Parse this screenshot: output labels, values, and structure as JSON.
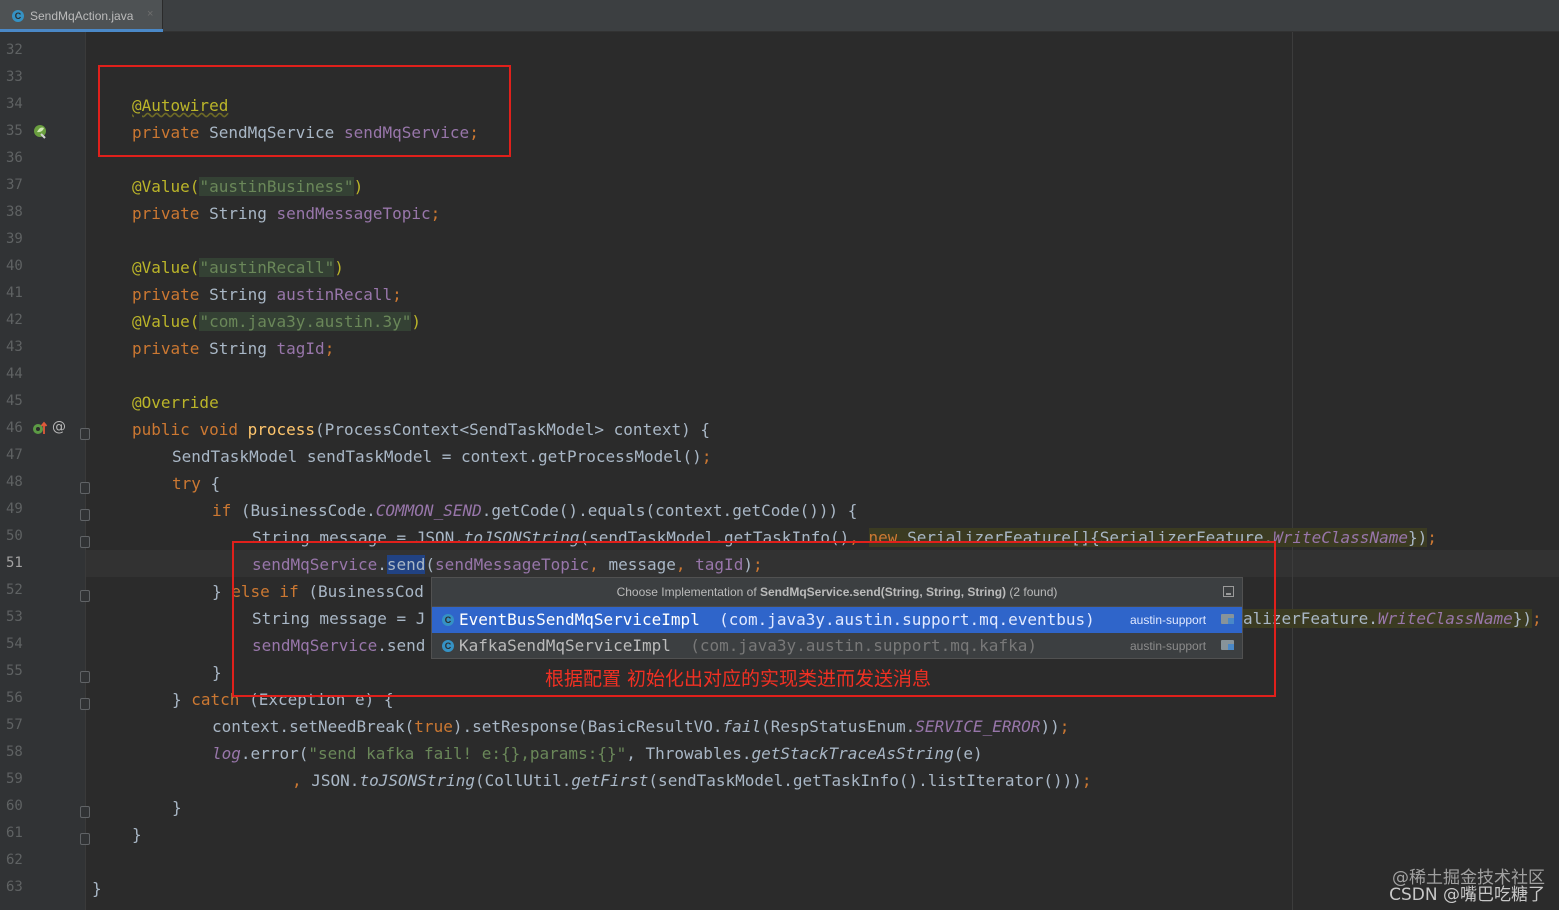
{
  "tab": {
    "icon": "C",
    "filename": "SendMqAction.java",
    "close": "×"
  },
  "gutter": {
    "line_numbers": [
      "32",
      "33",
      "34",
      "35",
      "36",
      "37",
      "38",
      "39",
      "40",
      "41",
      "42",
      "43",
      "44",
      "45",
      "46",
      "47",
      "48",
      "49",
      "50",
      "51",
      "52",
      "53",
      "54",
      "55",
      "56",
      "57",
      "58",
      "59",
      "60",
      "61",
      "62",
      "63"
    ],
    "current_line": "51",
    "icons": {
      "line35": "spring-bean-icon",
      "line46_override": "override-up-arrow-icon",
      "line46_at": "@"
    }
  },
  "code": {
    "l34_annotation": "@Autowired",
    "l35_private": "private",
    "l35_type": "SendMqService",
    "l35_field": "sendMqService",
    "l37_annotation": "@Value(",
    "l37_string": "\"austinBusiness\"",
    "l37_close": ")",
    "l38_private": "private",
    "l38_type": "String",
    "l38_field": "sendMessageTopic",
    "l40_annotation": "@Value(",
    "l40_string": "\"austinRecall\"",
    "l40_close": ")",
    "l41_private": "private",
    "l41_type": "String",
    "l41_field": "austinRecall",
    "l42_annotation": "@Value(",
    "l42_string": "\"com.java3y.austin.3y\"",
    "l42_close": ")",
    "l43_private": "private",
    "l43_type": "String",
    "l43_field": "tagId",
    "l45_annotation": "@Override",
    "l46_public": "public",
    "l46_void": "void",
    "l46_method": "process",
    "l46_rest": "(ProcessContext<SendTaskModel> context) {",
    "l47_text": "SendTaskModel sendTaskModel = context.getProcessModel()",
    "l48_try": "try",
    "l48_rest": " {",
    "l49_if": "if",
    "l49_a": " (BusinessCode.",
    "l49_const": "COMMON_SEND",
    "l49_b": ".getCode().equals(context.getCode())) {",
    "l50_a": "String message = JSON.",
    "l50_method": "toJSONString",
    "l50_b": "(sendTaskModel.getTaskInfo()",
    "l50_comma": ",",
    "l50_new": "new",
    "l50_c": "SerializerFeature[]{SerializerFeature.",
    "l50_const": "WriteClassName",
    "l50_d": "})",
    "l51_field": "sendMqService",
    "l51_dot": ".",
    "l51_send": "send",
    "l51_open": "(",
    "l51_arg1": "sendMessageTopic",
    "l51_comma1": ",",
    "l51_arg2": " message",
    "l51_comma2": ",",
    "l51_arg3": "tagId",
    "l51_close": ")",
    "l52_close": "} ",
    "l52_else": "else if",
    "l52_rest": " (BusinessCod",
    "l53_text": "String message = J",
    "l53_right": "alizerFeature.",
    "l53_const": "WriteClassName",
    "l53_end": "})",
    "l54_field": "sendMqService",
    "l54_text": ".send",
    "l55_text": "}",
    "l56_close": "} ",
    "l56_catch": "catch",
    "l56_rest": " (Exception e) {",
    "l57_a": "context.setNeedBreak(",
    "l57_true": "true",
    "l57_b": ").setResponse(BasicResultVO.",
    "l57_fail": "fail",
    "l57_c": "(RespStatusEnum.",
    "l57_const": "SERVICE_ERROR",
    "l57_d": "))",
    "l58_log": "log",
    "l58_a": ".error(",
    "l58_string": "\"send kafka fail! e:{},params:{}\"",
    "l58_b": ", Throwables.",
    "l58_method": "getStackTraceAsString",
    "l58_c": "(e)",
    "l59_comma": ",",
    "l59_a": " JSON.",
    "l59_method": "toJSONString",
    "l59_b": "(CollUtil.",
    "l59_method2": "getFirst",
    "l59_c": "(sendTaskModel.getTaskInfo().listIterator()))",
    "l60_text": "}",
    "l61_text": "}",
    "l63_text": "}",
    "semicolon": ";"
  },
  "popup": {
    "header_prefix": "Choose Implementation of ",
    "header_bold": "SendMqService.send(String, String, String)",
    "header_suffix": " (2 found)",
    "pin_icon": "pin-icon",
    "items": [
      {
        "icon": "C",
        "name": "EventBusSendMqServiceImpl",
        "package": "(com.java3y.austin.support.mq.eventbus)",
        "module": "austin-support",
        "selected": true
      },
      {
        "icon": "C",
        "name": "KafkaSendMqServiceImpl",
        "package": "(com.java3y.austin.support.mq.kafka)",
        "module": "austin-support",
        "selected": false
      }
    ]
  },
  "annotation_note": "根据配置 初始化出对应的实现类进而发送消息",
  "watermark": {
    "line1": "@稀土掘金技术社区",
    "line2": "CSDN @嘴巴吃糖了"
  },
  "colors": {
    "background": "#2b2b2b",
    "keyword": "#cc7832",
    "annotation": "#bbb529",
    "string": "#6a8759",
    "field": "#9876aa",
    "method": "#ffc66d",
    "highlight_box": "#e0201b",
    "popup_selection": "#2f65ca"
  }
}
